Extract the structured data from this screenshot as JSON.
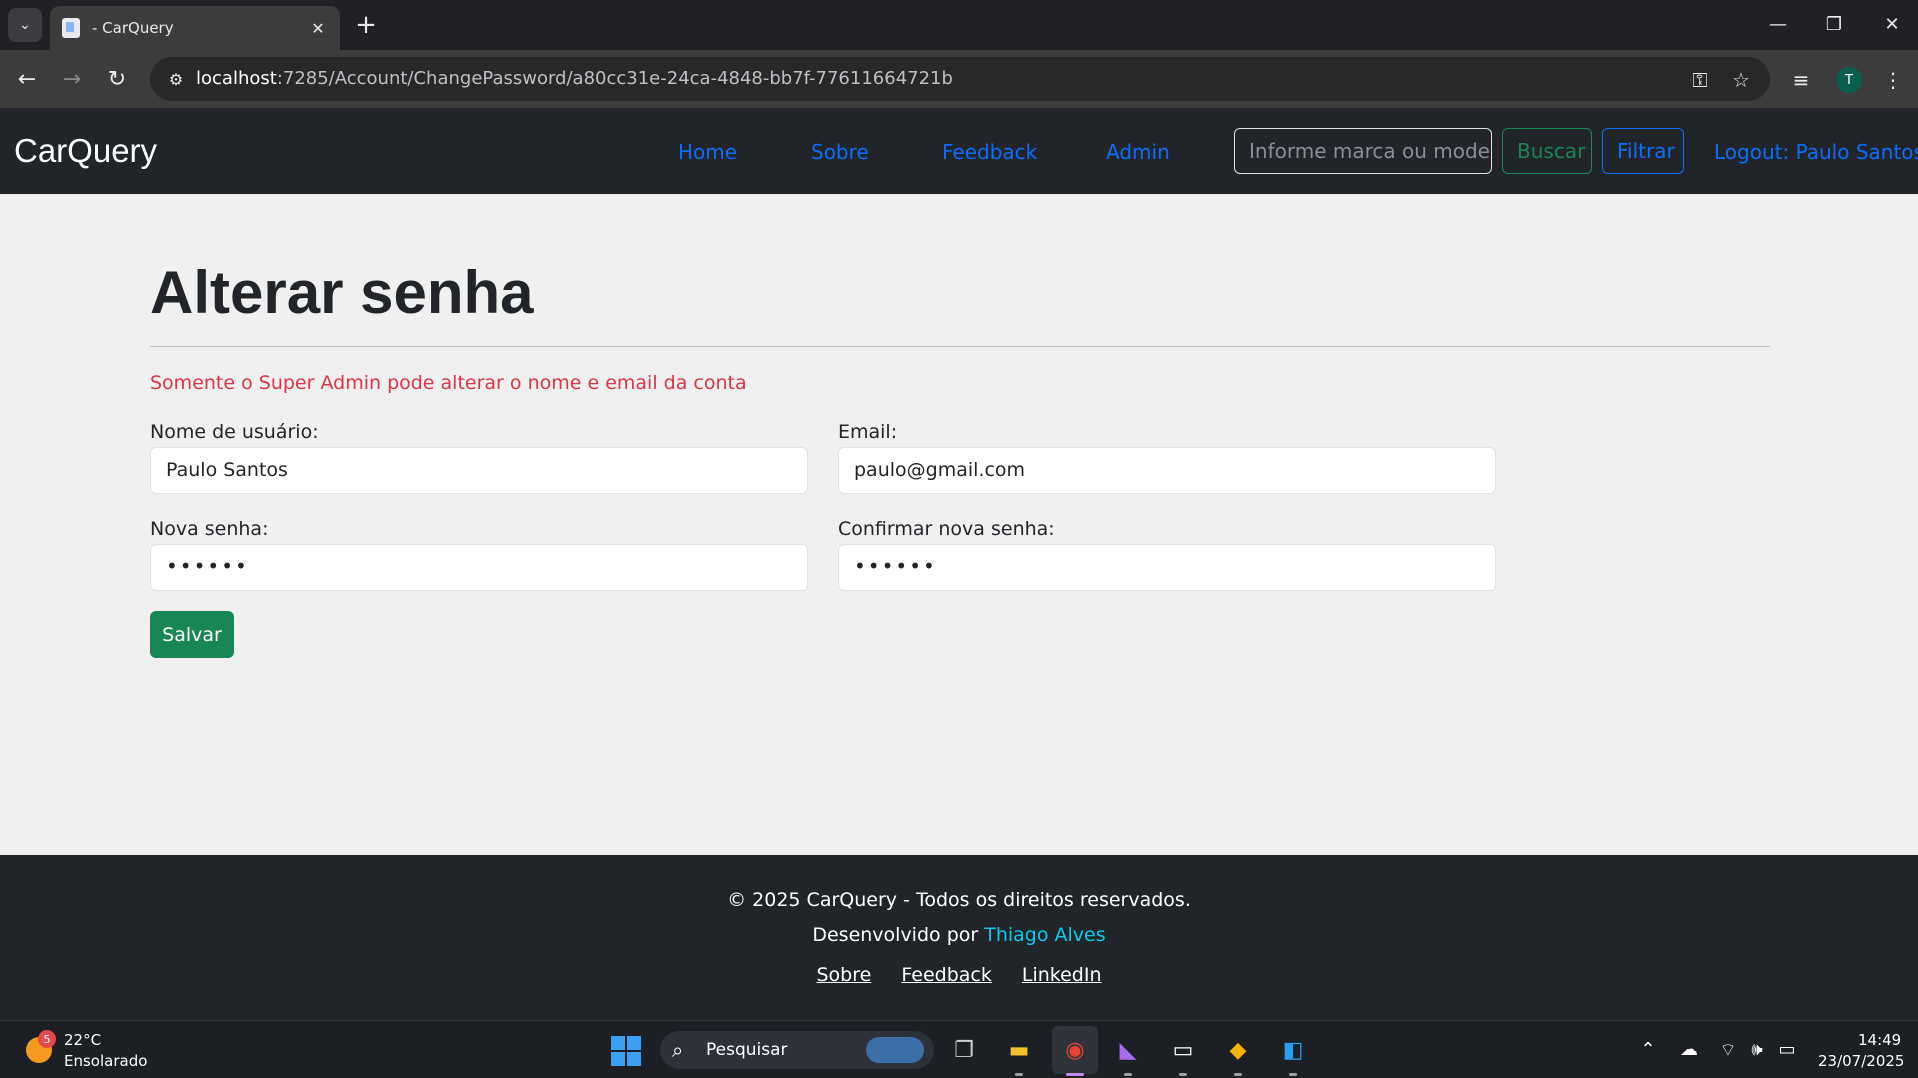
{
  "browser": {
    "tab_title": "- CarQuery",
    "tab_close": "✕",
    "new_tab": "+",
    "url_host": "localhost",
    "url_path": ":7285/Account/ChangePassword/a80cc31e-24ca-4848-bb7f-77611664721b",
    "profile_initial": "T",
    "window_controls": [
      "minimize-icon",
      "restore-icon",
      "close-icon"
    ]
  },
  "navbar": {
    "brand": "CarQuery",
    "links": [
      "Home",
      "Sobre",
      "Feedback",
      "Admin"
    ],
    "search_placeholder": "Informe marca ou modelo",
    "search_button": "Buscar",
    "filter_button": "Filtrar",
    "logout": "Logout: Paulo Santos",
    "colors": {
      "link": "#0d6efd",
      "success": "#198754",
      "bg": "#212529"
    }
  },
  "main": {
    "title": "Alterar senha",
    "notice": "Somente o Super Admin pode alterar o nome e email da conta",
    "username_label": "Nome de usuário:",
    "username_value": "Paulo Santos",
    "email_label": "Email:",
    "email_value": "paulo@gmail.com",
    "new_password_label": "Nova senha:",
    "new_password_value": "••••••",
    "confirm_password_label": "Confirmar nova senha:",
    "confirm_password_value": "••••••",
    "save_button": "Salvar",
    "colors": {
      "danger": "#dc3545",
      "save_bg": "#198754"
    }
  },
  "footer": {
    "copyright": "© 2025 CarQuery - Todos os direitos reservados.",
    "developed_by_prefix": "Desenvolvido por ",
    "developer": "Thiago Alves",
    "links": [
      "Sobre",
      "Feedback",
      "LinkedIn"
    ],
    "colors": {
      "developer_link": "#0dcaf0"
    }
  },
  "taskbar": {
    "weather_badge": "5",
    "temperature": "22°C",
    "weather_desc": "Ensolarado",
    "search_label": "Pesquisar",
    "time": "14:49",
    "date": "23/07/2025"
  }
}
